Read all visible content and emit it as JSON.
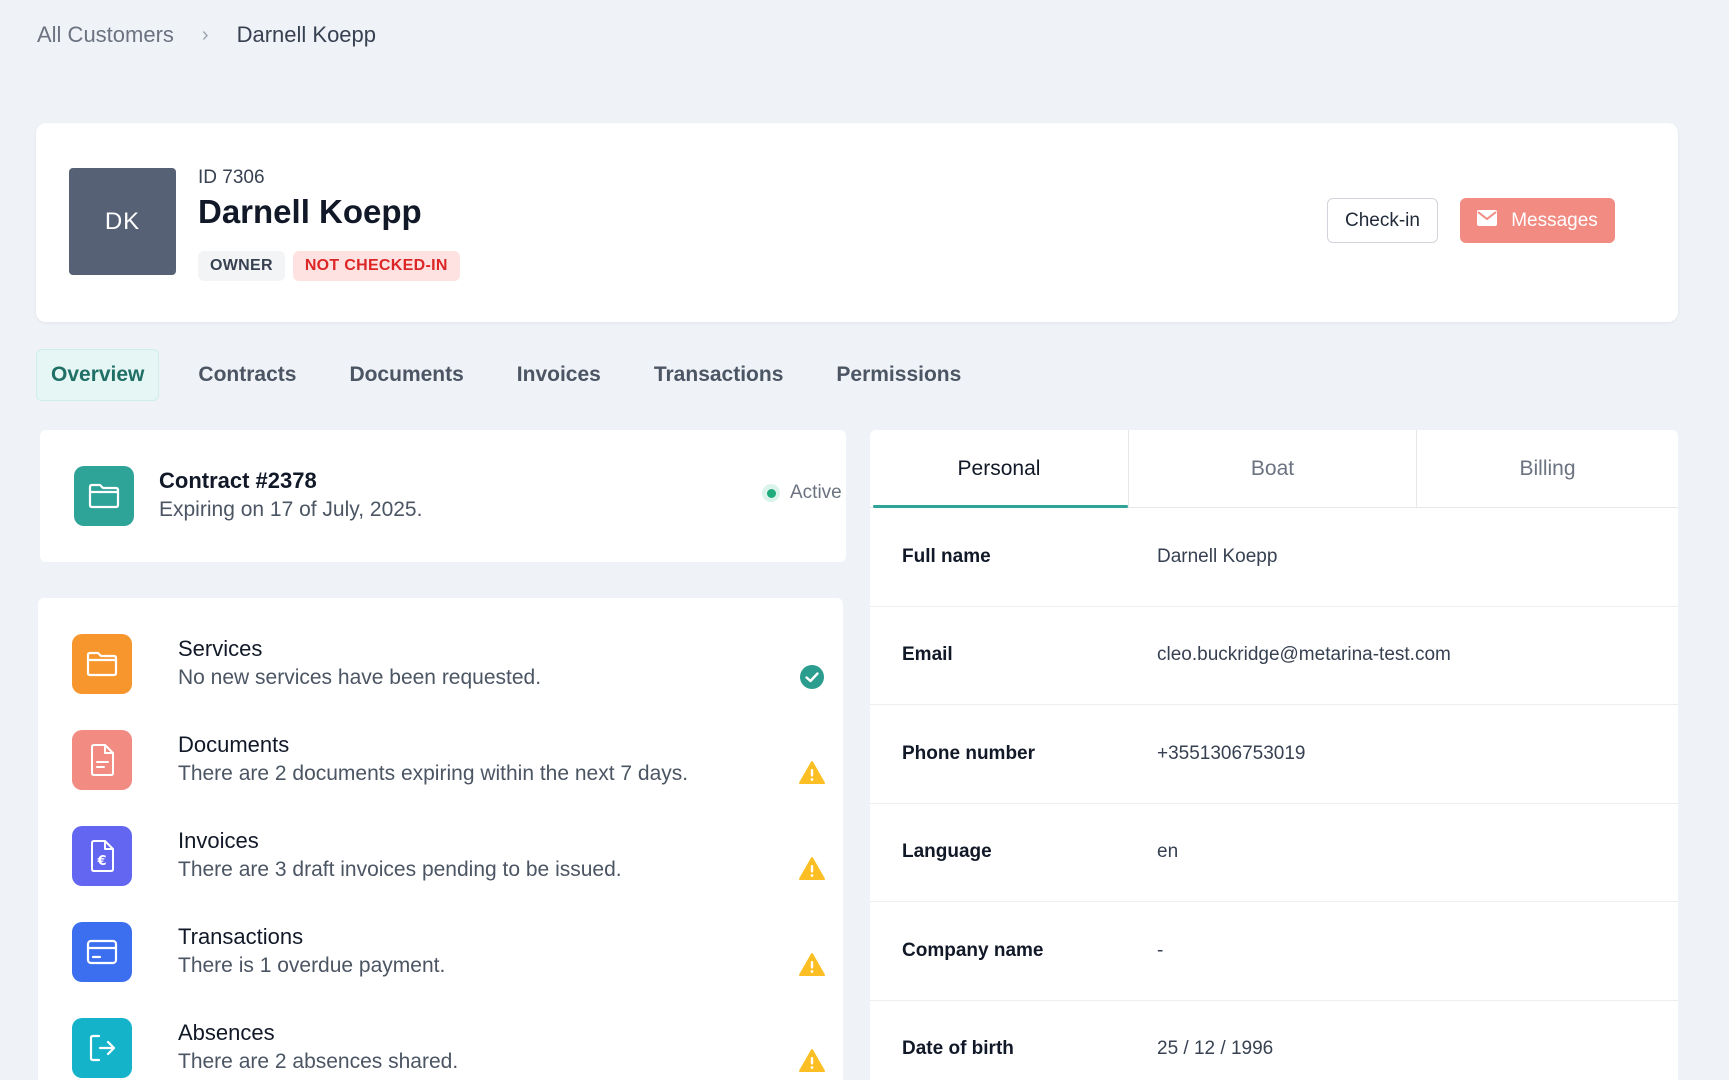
{
  "breadcrumb": {
    "parent": "All Customers",
    "separator": "›",
    "current": "Darnell Koepp"
  },
  "customer": {
    "initials": "DK",
    "id_label": "ID 7306",
    "name": "Darnell Koepp",
    "badges": {
      "role": "OWNER",
      "checkin_status": "NOT CHECKED-IN"
    },
    "actions": {
      "checkin": "Check-in",
      "messages": "Messages"
    }
  },
  "tabs": [
    "Overview",
    "Contracts",
    "Documents",
    "Invoices",
    "Transactions",
    "Permissions"
  ],
  "active_tab": "Overview",
  "contract": {
    "title": "Contract #2378",
    "subtitle": "Expiring on 17 of July, 2025.",
    "status": "Active"
  },
  "notices": [
    {
      "title": "Services",
      "description": "No new services have been requested.",
      "icon": "folder-icon",
      "state": "ok"
    },
    {
      "title": "Documents",
      "description": "There are 2 documents expiring within the next 7 days.",
      "icon": "document-icon",
      "state": "warning"
    },
    {
      "title": "Invoices",
      "description": "There are 3 draft invoices pending to be issued.",
      "icon": "euro-invoice-icon",
      "state": "warning"
    },
    {
      "title": "Transactions",
      "description": "There is 1 overdue payment.",
      "icon": "credit-card-icon",
      "state": "warning"
    },
    {
      "title": "Absences",
      "description": "There are 2 absences shared.",
      "icon": "exit-icon",
      "state": "warning"
    }
  ],
  "details": {
    "tabs": [
      "Personal",
      "Boat",
      "Billing"
    ],
    "active_tab": "Personal",
    "rows": [
      {
        "label": "Full name",
        "value": "Darnell Koepp"
      },
      {
        "label": "Email",
        "value": "cleo.buckridge@metarina-test.com"
      },
      {
        "label": "Phone number",
        "value": "+3551306753019"
      },
      {
        "label": "Language",
        "value": "en"
      },
      {
        "label": "Company name",
        "value": "-"
      },
      {
        "label": "Date of birth",
        "value": "25 / 12 / 1996"
      }
    ]
  },
  "colors": {
    "background": "#eff2f6",
    "accent_teal": "#2ea398",
    "messages_button": "#f28b82",
    "avatar": "#566176",
    "services_icon": "#f7962d",
    "documents_icon": "#f28b82",
    "invoices_icon": "#6366f1",
    "transactions_icon": "#3b6ff0",
    "absences_icon": "#14b3c9",
    "warning": "#fbbf24",
    "ok": "#2a9d8f"
  }
}
